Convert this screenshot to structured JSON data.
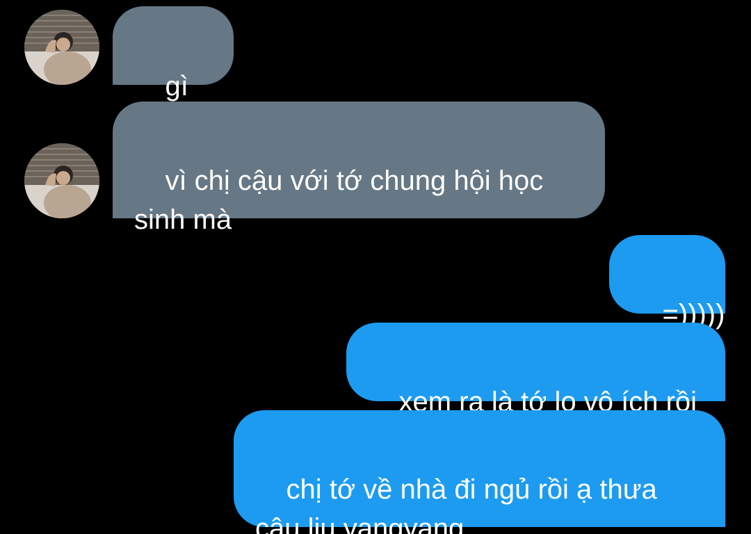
{
  "conversation": {
    "messages": [
      {
        "sender": "other",
        "text": "gì thế"
      },
      {
        "sender": "other",
        "text": "vì chị cậu với tớ chung hội học\nsinh mà"
      },
      {
        "sender": "me",
        "text": "=)))))"
      },
      {
        "sender": "me",
        "text": "xem ra là tớ lo vô ích rồi"
      },
      {
        "sender": "me",
        "text": "chị tớ về nhà đi ngủ rồi ạ thưa\ncậu liu yangyang"
      }
    ]
  },
  "colors": {
    "background": "#000000",
    "incoming_bubble": "#667785",
    "outgoing_bubble": "#1d9bf0",
    "text": "#ffffff"
  },
  "icons": {
    "avatar": "contact-avatar-photo"
  }
}
